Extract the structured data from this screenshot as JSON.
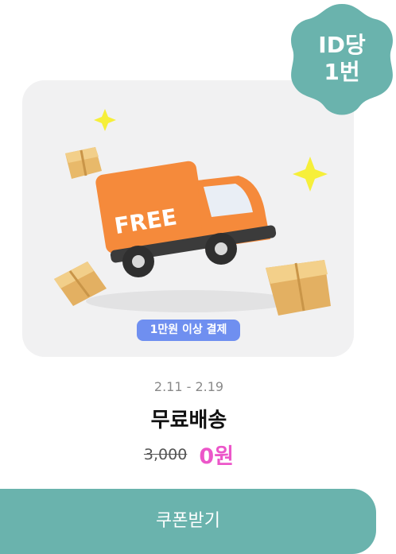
{
  "badge": {
    "line1": "ID당",
    "line2": "1번",
    "color": "#6ab3ad"
  },
  "illustration": {
    "truck_text": "FREE",
    "truck_color": "#f58a3b"
  },
  "condition_label": "1만원 이상 결제",
  "date_range": "2.11 - 2.19",
  "title": "무료배송",
  "price": {
    "original": "3,000",
    "sale": "0원",
    "sale_color": "#ec56c9"
  },
  "cta": {
    "label": "쿠폰받기",
    "color": "#6ab3ad"
  }
}
